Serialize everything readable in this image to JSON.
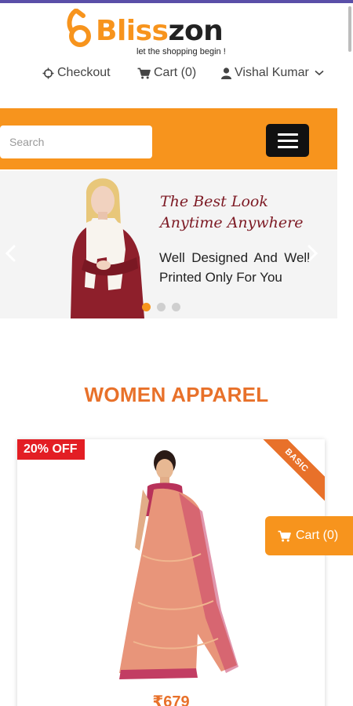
{
  "brand": {
    "name_part1": "Bliss",
    "name_part2": "zon",
    "tagline": "let the shopping begin !",
    "colors": {
      "primary": "#f7941d",
      "accent": "#e8712a",
      "dark": "#222222"
    }
  },
  "topnav": {
    "checkout": {
      "label": "Checkout",
      "icon": "crosshair-icon"
    },
    "cart": {
      "label": "Cart (0)",
      "icon": "cart-icon"
    },
    "user": {
      "label": "Vishal Kumar",
      "icon": "user-icon",
      "caret": "chevron-down-icon"
    }
  },
  "search": {
    "placeholder": "Search",
    "value": ""
  },
  "menu_button": {
    "icon": "hamburger-icon"
  },
  "slider": {
    "heading_line1": "The Best Look",
    "heading_line2": "Anytime Anywhere",
    "subtext": "Well Designed And Well Printed Only For You",
    "slide_count": 3,
    "active_slide": 1,
    "prev_icon": "chevron-left-icon",
    "next_icon": "chevron-right-icon"
  },
  "section": {
    "title": "WOMEN APPAREL"
  },
  "product": {
    "discount": "20% OFF",
    "ribbon": "BASIC",
    "price": "₹679"
  },
  "floating_cart": {
    "label": "Cart (0)",
    "icon": "cart-icon"
  }
}
